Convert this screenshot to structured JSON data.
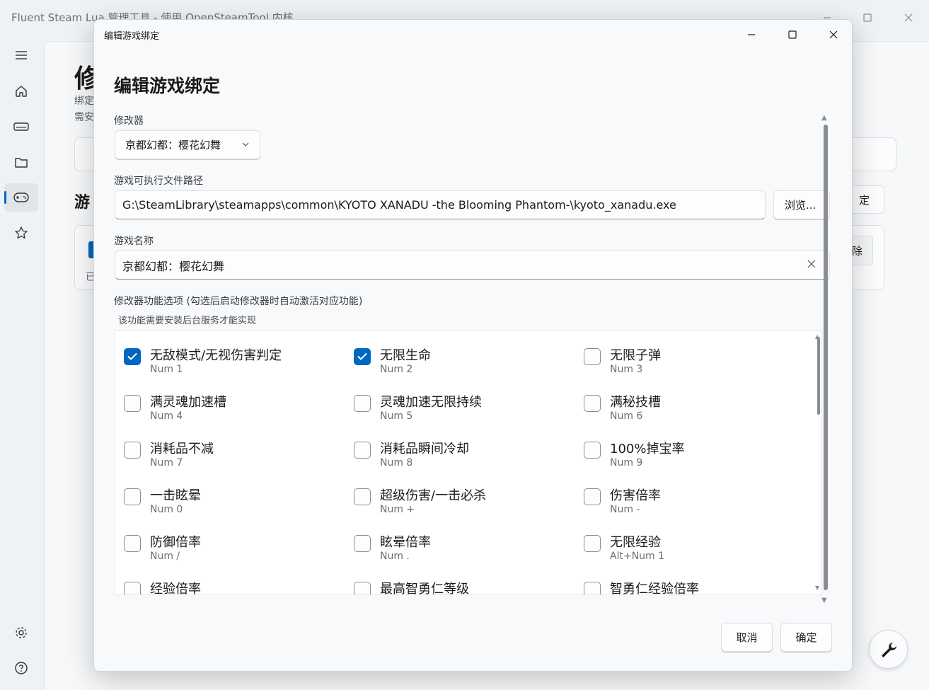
{
  "app": {
    "title": "Fluent Steam Lua 管理工具 - 使用 OpenSteamTool 内核",
    "bg_heading": "修",
    "bg_sub1": "绑定",
    "bg_sub2": "需安",
    "bg_section": "游",
    "bg_bind_button": "定",
    "bg_card_text": "已",
    "bg_delete_button": "除",
    "sidebar_items": [
      "menu-icon",
      "home-icon",
      "drive-icon",
      "folder-icon",
      "gamepad-icon",
      "star-icon",
      "settings-icon",
      "help-icon"
    ]
  },
  "dialog": {
    "window_title": "编辑游戏绑定",
    "heading": "编辑游戏绑定",
    "trainer_label": "修改器",
    "trainer_selected": "京都幻都：樱花幻舞",
    "exe_label": "游戏可执行文件路径",
    "exe_path": "G:\\SteamLibrary\\steamapps\\common\\KYOTO XANADU -the Blooming Phantom-\\kyoto_xanadu.exe",
    "browse_label": "浏览...",
    "name_label": "游戏名称",
    "game_name": "京都幻都：樱花幻舞",
    "options_label": "修改器功能选项 (勾选后启动修改器时自动激活对应功能)",
    "options_note": "该功能需要安装后台服务才能实现",
    "options": [
      {
        "label": "无敌模式/无视伤害判定",
        "key": "Num 1",
        "checked": true
      },
      {
        "label": "无限生命",
        "key": "Num 2",
        "checked": true
      },
      {
        "label": "无限子弹",
        "key": "Num 3",
        "checked": false
      },
      {
        "label": "满灵魂加速槽",
        "key": "Num 4",
        "checked": false
      },
      {
        "label": "灵魂加速无限持续",
        "key": "Num 5",
        "checked": false
      },
      {
        "label": "满秘技槽",
        "key": "Num 6",
        "checked": false
      },
      {
        "label": "消耗品不减",
        "key": "Num 7",
        "checked": false
      },
      {
        "label": "消耗品瞬间冷却",
        "key": "Num 8",
        "checked": false
      },
      {
        "label": "100%掉宝率",
        "key": "Num 9",
        "checked": false
      },
      {
        "label": "一击眩晕",
        "key": "Num 0",
        "checked": false
      },
      {
        "label": "超级伤害/一击必杀",
        "key": "Num +",
        "checked": false
      },
      {
        "label": "伤害倍率",
        "key": "Num -",
        "checked": false
      },
      {
        "label": "防御倍率",
        "key": "Num /",
        "checked": false
      },
      {
        "label": "眩晕倍率",
        "key": "Num .",
        "checked": false
      },
      {
        "label": "无限经验",
        "key": "Alt+Num 1",
        "checked": false
      },
      {
        "label": "经验倍率",
        "key": "",
        "checked": false
      },
      {
        "label": "最高智勇仁等级",
        "key": "",
        "checked": false
      },
      {
        "label": "智勇仁经验倍率",
        "key": "",
        "checked": false
      }
    ],
    "cancel_label": "取消",
    "ok_label": "确定"
  },
  "colors": {
    "accent": "#0067c0",
    "dialog_bg": "#f7f9fb",
    "panel_bg": "#ffffff"
  }
}
